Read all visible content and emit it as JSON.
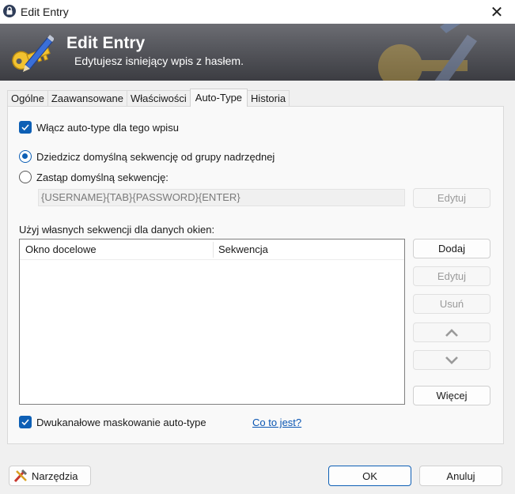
{
  "window": {
    "title": "Edit Entry"
  },
  "banner": {
    "title": "Edit Entry",
    "subtitle": "Edytujesz isniejący wpis z hasłem."
  },
  "tabs": [
    {
      "label": "Ogólne"
    },
    {
      "label": "Zaawansowane"
    },
    {
      "label": "Właściwości"
    },
    {
      "label": "Auto-Type",
      "active": true
    },
    {
      "label": "Historia"
    }
  ],
  "autotype": {
    "enable_label": "Włącz auto-type dla tego wpisu",
    "enable_checked": true,
    "inherit_label": "Dziedzicz domyślną sekwencję od grupy nadrzędnej",
    "override_label": "Zastąp domyślną sekwencję:",
    "sequence_value": "{USERNAME}{TAB}{PASSWORD}{ENTER}",
    "edit_label": "Edytuj",
    "custom_label": "Użyj własnych sekwencji dla danych okien:",
    "columns": [
      "Okno docelowe",
      "Sekwencja"
    ],
    "rows": [],
    "add_label": "Dodaj",
    "edit2_label": "Edytuj",
    "remove_label": "Usuń",
    "more_label": "Więcej",
    "obfuscation_label": "Dwukanałowe maskowanie auto-type",
    "obfuscation_checked": true,
    "whatis_label": "Co to jest?"
  },
  "footer": {
    "tools_label": "Narzędzia",
    "ok_label": "OK",
    "cancel_label": "Anuluj"
  },
  "colors": {
    "accent": "#0d5fb5",
    "banner": "#5a5b61",
    "link": "#0a56b3"
  }
}
